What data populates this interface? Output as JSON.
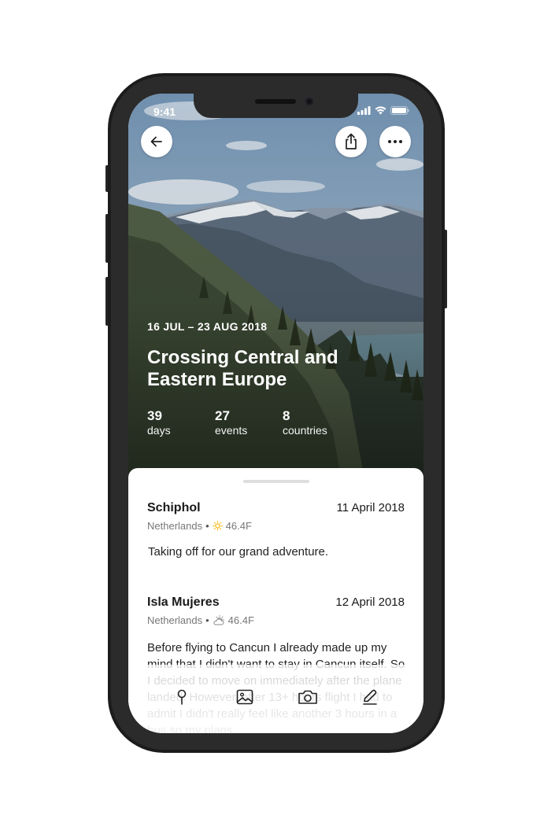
{
  "status_bar": {
    "time": "9:41"
  },
  "hero": {
    "date_range": "16 JUL – 23 AUG 2018",
    "title": "Crossing Central and Eastern Europe",
    "stats": [
      {
        "value": "39",
        "label": "days"
      },
      {
        "value": "27",
        "label": "events"
      },
      {
        "value": "8",
        "label": "countries"
      }
    ]
  },
  "entries": [
    {
      "place": "Schiphol",
      "date": "11 April 2018",
      "country": "Netherlands",
      "weather_icon": "sun-icon",
      "temperature": "46.4F",
      "text": "Taking off for our grand adventure."
    },
    {
      "place": "Isla Mujeres",
      "date": "12 April 2018",
      "country": "Netherlands",
      "weather_icon": "partly-cloudy-icon",
      "temperature": "46.4F",
      "text": "Before flying to Cancun I already made up my mind that I didn't want to stay in Cancun itself. So I decided to move on immediately after the plane landed. However, after 13+ hours flight I had to admit I didn't really feel like another 3 hours in a bus so my plans"
    }
  ],
  "toolbar": {
    "icons": [
      "location-pin-icon",
      "image-icon",
      "camera-icon",
      "pencil-icon"
    ]
  },
  "colors": {
    "accent_sun": "#F5B400",
    "text_primary": "#1A1A1A",
    "text_muted": "#777777"
  }
}
